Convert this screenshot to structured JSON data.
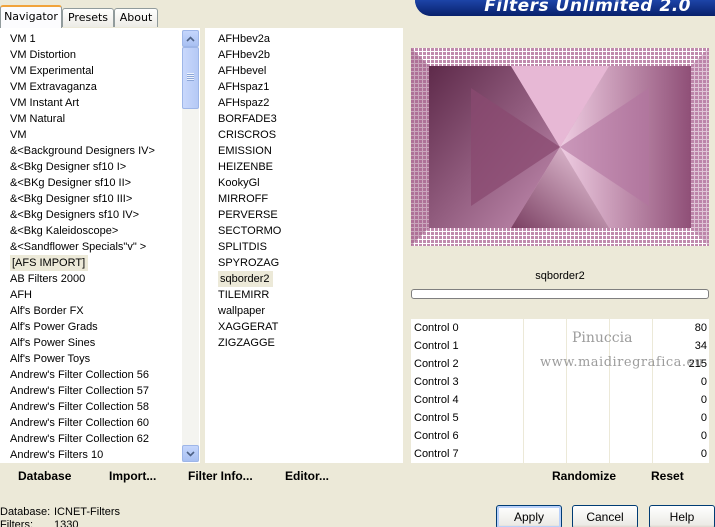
{
  "tabs": [
    {
      "label": "Navigator",
      "active": true
    },
    {
      "label": "Presets",
      "active": false
    },
    {
      "label": "About",
      "active": false
    }
  ],
  "banner": {
    "title": "Filters Unlimited 2.0"
  },
  "categories": [
    "VM 1",
    "VM Distortion",
    "VM Experimental",
    "VM Extravaganza",
    "VM Instant Art",
    "VM Natural",
    "VM",
    "&<Background Designers IV>",
    "&<Bkg Designer sf10 I>",
    "&<BKg Designer sf10 II>",
    "&<Bkg Designer sf10 III>",
    "&<Bkg Designers sf10 IV>",
    "&<Bkg Kaleidoscope>",
    "&<Sandflower Specials\"v\" >",
    "[AFS IMPORT]",
    "AB Filters 2000",
    "AFH",
    "Alf's Border FX",
    "Alf's Power Grads",
    "Alf's Power Sines",
    "Alf's Power Toys",
    "Andrew's Filter Collection 56",
    "Andrew's Filter Collection 57",
    "Andrew's Filter Collection 58",
    "Andrew's Filter Collection 60",
    "Andrew's Filter Collection 62",
    "Andrew's Filters 10"
  ],
  "selected_category": "[AFS IMPORT]",
  "filters": [
    "AFHbev2a",
    "AFHbev2b",
    "AFHbevel",
    "AFHspaz1",
    "AFHspaz2",
    "BORFADE3",
    "CRISCROS",
    "EMISSION",
    "HEIZENBE",
    "KookyGl",
    "MIRROFF",
    "PERVERSE",
    "SECTORMO",
    "SPLITDIS",
    "SPYROZAG",
    "sqborder2",
    "TILEMIRR",
    "wallpaper",
    "XAGGERAT",
    "ZIGZAGGE"
  ],
  "selected_filter": "sqborder2",
  "toolbar": {
    "database": "Database",
    "import": "Import...",
    "filter_info": "Filter Info...",
    "editor": "Editor..."
  },
  "preview": {
    "filter_name": "sqborder2"
  },
  "controls": [
    {
      "label": "Control 0",
      "value": "80"
    },
    {
      "label": "Control 1",
      "value": "34"
    },
    {
      "label": "Control 2",
      "value": "215"
    },
    {
      "label": "Control 3",
      "value": "0"
    },
    {
      "label": "Control 4",
      "value": "0"
    },
    {
      "label": "Control 5",
      "value": "0"
    },
    {
      "label": "Control 6",
      "value": "0"
    },
    {
      "label": "Control 7",
      "value": "0"
    }
  ],
  "watermark": {
    "line1": "Pinuccia",
    "line2": "www.maidiregrafica.eu"
  },
  "actions": {
    "randomize": "Randomize",
    "reset": "Reset"
  },
  "status": {
    "database_label": "Database:",
    "database_value": "ICNET-Filters",
    "filters_label": "Filters:",
    "filters_value": "1330"
  },
  "buttons": {
    "apply": "Apply",
    "cancel": "Cancel",
    "help": "Help"
  },
  "colors": {
    "preview_dark": "#7a3f62",
    "preview_light": "#e8b9d6",
    "banner": "#0a2a7a"
  }
}
